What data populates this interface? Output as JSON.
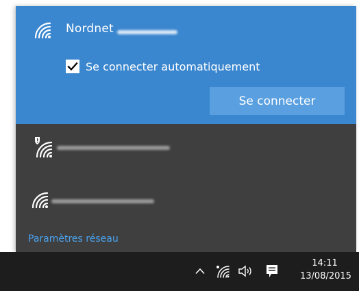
{
  "flyout": {
    "selected_network": {
      "name": "Nordnet",
      "auto_connect_label": "Se connecter automatiquement",
      "auto_connect_checked": true,
      "connect_button_label": "Se connecter"
    },
    "other_networks": [
      {
        "secured_warning": true
      },
      {
        "secured_warning": false
      }
    ],
    "settings_link_label": "Paramètres réseau"
  },
  "taskbar": {
    "tray_icons": [
      "chevron-up-icon",
      "wifi-icon",
      "volume-icon",
      "action-center-icon"
    ],
    "time": "14:11",
    "date": "13/08/2015"
  },
  "colors": {
    "selected_bg": "#3a86cf",
    "button_bg": "#5aa0e0",
    "flyout_bg": "#3f3f3f",
    "taskbar_bg": "#1d1d1d",
    "link": "#4aa3f0"
  }
}
